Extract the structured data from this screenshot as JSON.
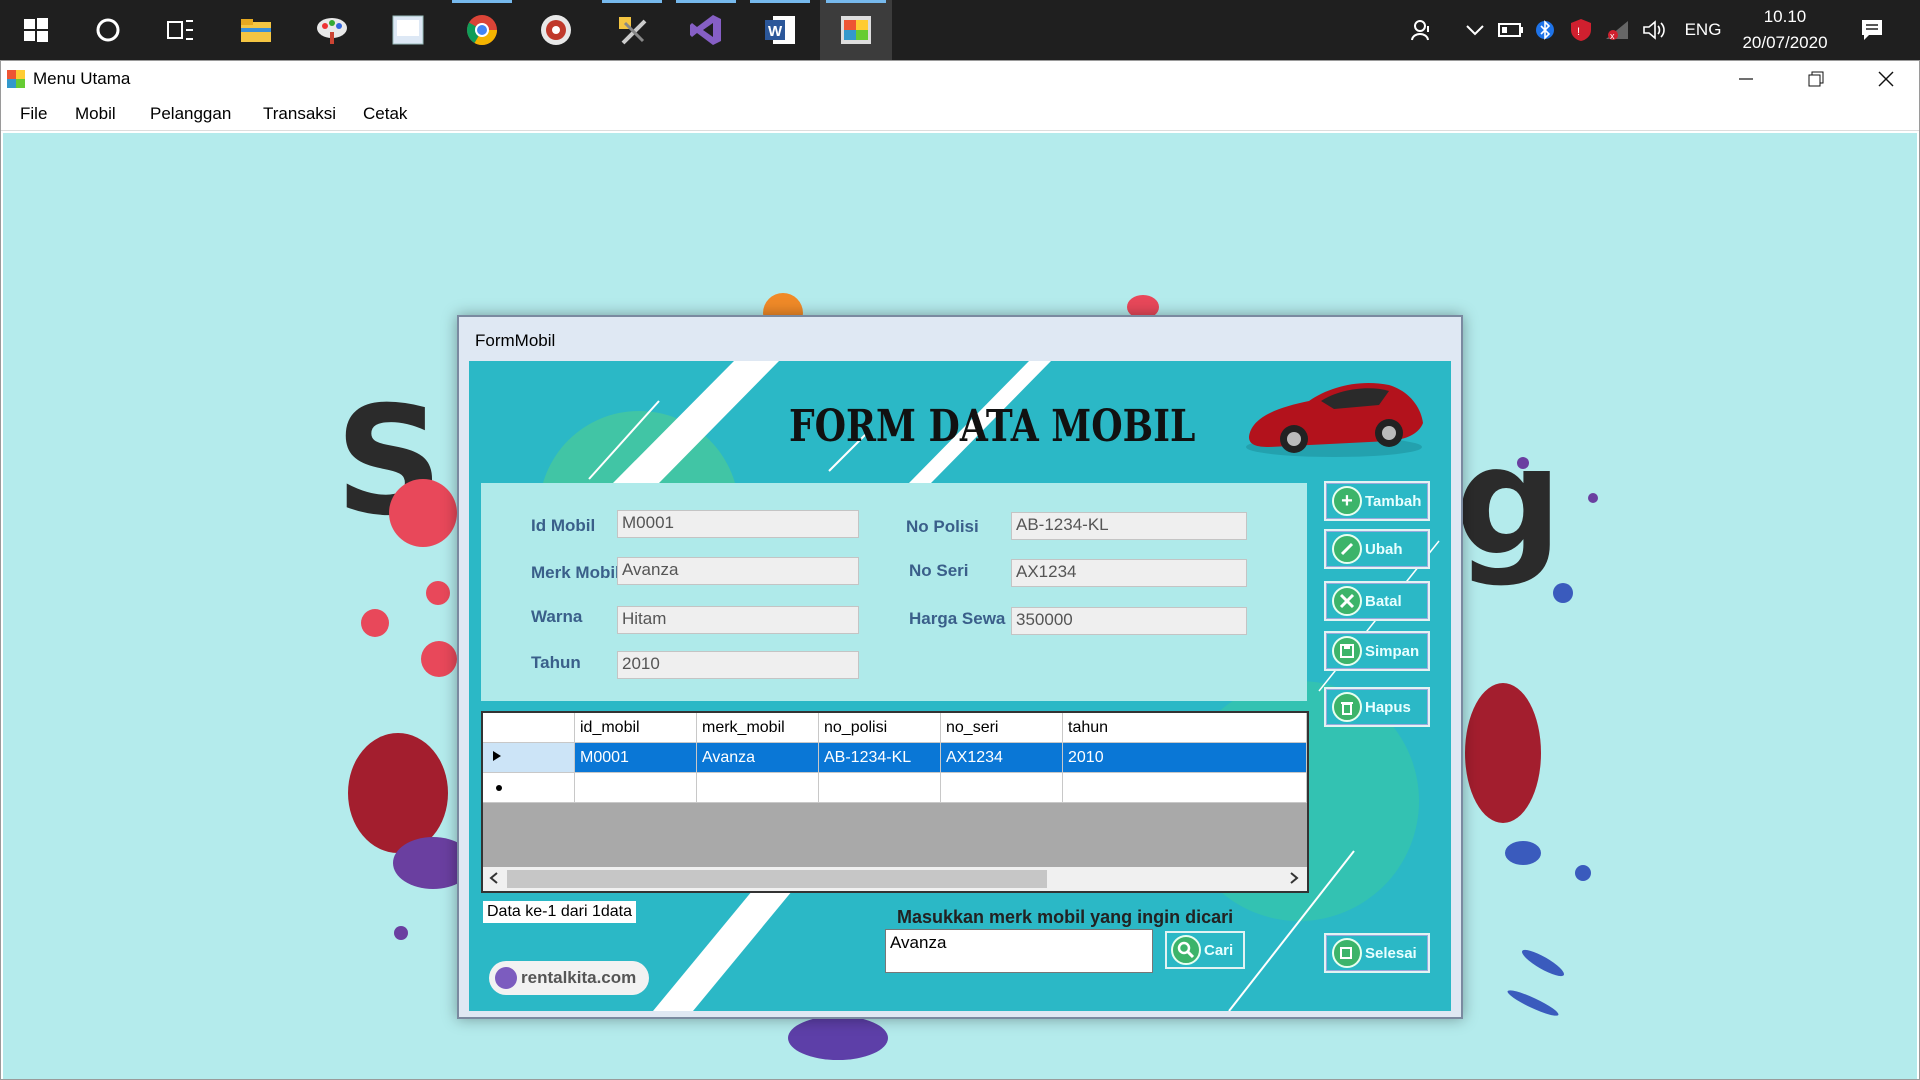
{
  "taskbar": {
    "icons": [
      "windows-start-icon",
      "cortana-icon",
      "task-view-icon",
      "file-explorer-icon",
      "paint-icon",
      "app-icon",
      "chrome-icon",
      "media-icon",
      "tools-icon",
      "visual-studio-icon",
      "word-icon",
      "winforms-app-icon"
    ],
    "tray": {
      "language": "ENG",
      "time": "10.10",
      "date": "20/07/2020"
    }
  },
  "window": {
    "title": "Menu Utama",
    "menu": [
      "File",
      "Mobil",
      "Pelanggan",
      "Transaksi",
      "Cetak"
    ]
  },
  "form": {
    "title": "FormMobil",
    "heading": "FORM DATA MOBIL",
    "fields": {
      "id_mobil_label": "Id Mobil",
      "id_mobil_value": "M0001",
      "merk_label": "Merk Mobil",
      "merk_value": "Avanza",
      "warna_label": "Warna",
      "warna_value": "Hitam",
      "tahun_label": "Tahun",
      "tahun_value": "2010",
      "no_polisi_label": "No Polisi",
      "no_polisi_value": "AB-1234-KL",
      "no_seri_label": "No Seri",
      "no_seri_value": "AX1234",
      "harga_label": "Harga Sewa",
      "harga_value": "350000"
    },
    "buttons": {
      "tambah": "Tambah",
      "ubah": "Ubah",
      "batal": "Batal",
      "simpan": "Simpan",
      "hapus": "Hapus",
      "selesai": "Selesai",
      "cari": "Cari"
    },
    "grid": {
      "columns": [
        "id_mobil",
        "merk_mobil",
        "no_polisi",
        "no_seri",
        "tahun"
      ],
      "rows": [
        [
          "M0001",
          "Avanza",
          "AB-1234-KL",
          "AX1234",
          "2010"
        ]
      ]
    },
    "status": "Data ke-1 dari 1data",
    "search_prompt": "Masukkan merk mobil yang ingin dicari",
    "search_value": "Avanza",
    "brand": "rentalkita.com"
  },
  "colors": {
    "desktop_bg": "#b4ebec",
    "form_bg": "#2bb8c6",
    "selection": "#0a77d6",
    "button_icon": "#3cb46a"
  }
}
